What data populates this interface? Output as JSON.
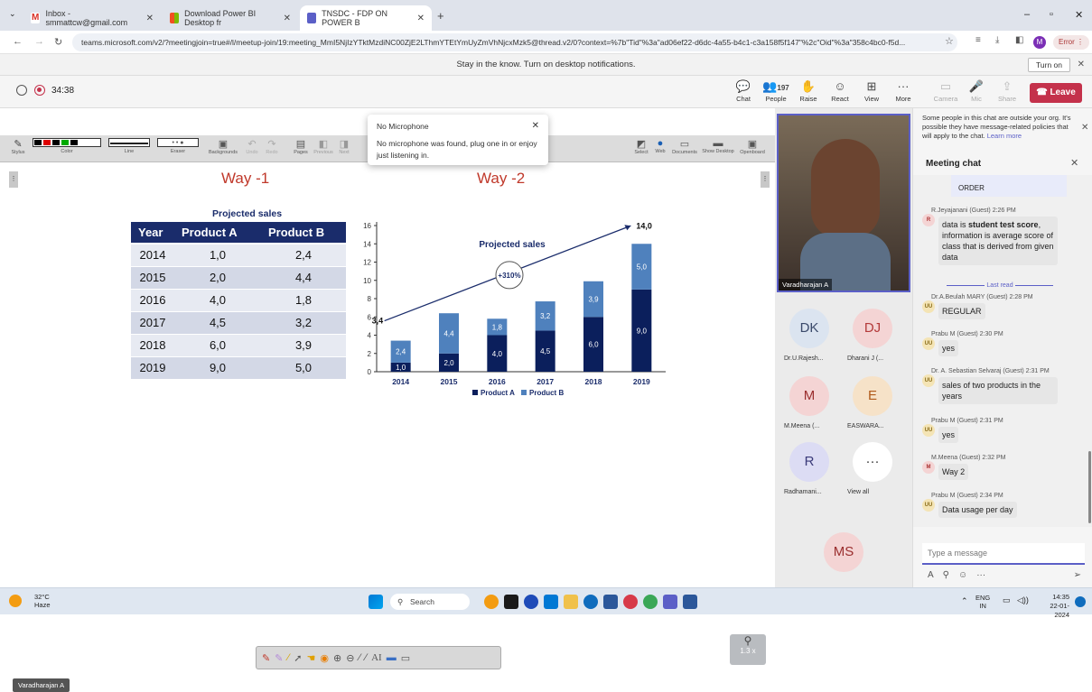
{
  "browser": {
    "tabs": [
      {
        "label": "Inbox - smmattcw@gmail.com",
        "icon": "gmail-icon",
        "color": "#d93025"
      },
      {
        "label": "Download Power BI Desktop fr",
        "icon": "microsoft-icon",
        "color": "#f25022"
      },
      {
        "label": "TNSDC - FDP ON POWER B",
        "icon": "teams-icon",
        "color": "#5b5fc7"
      }
    ],
    "url": "teams.microsoft.com/v2/?meetingjoin=true#/l/meetup-join/19:meeting_MmI5NjIzYTktMzdiNC00ZjE2LThmYTEtYmUyZmVhNjcxMzk5@thread.v2/0?context=%7b\"Tid\"%3a\"ad06ef22-d6dc-4a55-b4c1-c3a158f5f147\"%2c\"Oid\"%3a\"358c4bc0-f5d...",
    "profile_initial": "M",
    "error_label": "Error"
  },
  "notification": {
    "text": "Stay in the know. Turn on desktop notifications.",
    "button": "Turn on"
  },
  "meeting": {
    "timer": "34:38",
    "toolbar": [
      {
        "label": "Chat",
        "icon": "chat-icon",
        "name": "chat"
      },
      {
        "label": "People",
        "icon": "people-icon",
        "name": "people",
        "count": "197"
      },
      {
        "label": "Raise",
        "icon": "raise-hand-icon",
        "name": "raise"
      },
      {
        "label": "React",
        "icon": "react-icon",
        "name": "react"
      },
      {
        "label": "View",
        "icon": "view-icon",
        "name": "view"
      },
      {
        "label": "More",
        "icon": "more-icon",
        "name": "more"
      },
      {
        "label": "Camera",
        "icon": "camera-icon",
        "name": "camera"
      },
      {
        "label": "Mic",
        "icon": "mic-icon",
        "name": "mic"
      },
      {
        "label": "Share",
        "icon": "share-icon",
        "name": "share"
      }
    ],
    "leave": "Leave"
  },
  "popup": {
    "title": "No Microphone",
    "body": "No microphone was found, plug one in or enjoy just listening in."
  },
  "whiteboard": {
    "tool_labels": [
      "Stylus",
      "Color",
      "Line",
      "Eraser",
      "Backgrounds",
      "Undo",
      "Redo",
      "Pages",
      "Previous",
      "Next"
    ],
    "right_tool_labels": [
      "Select",
      "Web",
      "Documents",
      "Show Desktop",
      "Openboard"
    ]
  },
  "slide": {
    "way1": "Way -1",
    "way2": "Way -2",
    "table_title": "Projected sales",
    "table_headers": [
      "Year",
      "Product A",
      "Product B"
    ],
    "table_rows": [
      [
        "2014",
        "1,0",
        "2,4"
      ],
      [
        "2015",
        "2,0",
        "4,4"
      ],
      [
        "2016",
        "4,0",
        "1,8"
      ],
      [
        "2017",
        "4,5",
        "3,2"
      ],
      [
        "2018",
        "6,0",
        "3,9"
      ],
      [
        "2019",
        "9,0",
        "5,0"
      ]
    ]
  },
  "chart_data": {
    "type": "bar",
    "title": "Projected sales",
    "categories": [
      "2014",
      "2015",
      "2016",
      "2017",
      "2018",
      "2019"
    ],
    "series": [
      {
        "name": "Product A",
        "values": [
          1.0,
          2.0,
          4.0,
          4.5,
          6.0,
          9.0
        ],
        "labels": [
          "1,0",
          "2,0",
          "4,0",
          "4,5",
          "6,0",
          "9,0"
        ],
        "color": "#0b1f5c"
      },
      {
        "name": "Product B",
        "values": [
          2.4,
          4.4,
          1.8,
          3.2,
          3.9,
          5.0
        ],
        "labels": [
          "2,4",
          "4,4",
          "1,8",
          "3,2",
          "3,9",
          "5,0"
        ],
        "color": "#4f81bd"
      }
    ],
    "ylim": [
      0,
      16
    ],
    "yticks": [
      "0",
      "2",
      "4",
      "6",
      "8",
      "10",
      "12",
      "14",
      "16"
    ],
    "stacked": true,
    "legend": "bottom",
    "annotations": {
      "start": "3,4",
      "end": "14,0",
      "growth": "+310%"
    }
  },
  "zoom": "1.3 x",
  "presenter_badge": "Varadharajan A",
  "participants": {
    "video_name": "Varadharajan A",
    "tiles": [
      {
        "initials": "DK",
        "name": "Dr.U.Rajesh...",
        "bg": "#dbe4f0",
        "fg": "#3b4a6b"
      },
      {
        "initials": "DJ",
        "name": "Dharani J (...",
        "bg": "#f4d4d4",
        "fg": "#b33a3a"
      },
      {
        "initials": "M",
        "name": "M.Meena (...",
        "bg": "#f4d4d4",
        "fg": "#9a2e2e"
      },
      {
        "initials": "E",
        "name": "EASWARA...",
        "bg": "#f6e2c8",
        "fg": "#b05a1a"
      },
      {
        "initials": "R",
        "name": "Radhamani...",
        "bg": "#dcdcf4",
        "fg": "#3b3b7a"
      },
      {
        "initials": "···",
        "name": "View all",
        "bg": "#ffffff",
        "fg": "#333333"
      }
    ],
    "self_initials": "MS"
  },
  "chat": {
    "banner": "Some people in this chat are outside your org. It's possible they have message-related policies that will apply to the chat.",
    "banner_link": "Learn more",
    "title": "Meeting chat",
    "top_snippet": "ORDER",
    "messages": [
      {
        "meta": "R.Jeyajanani (Guest)  2:26 PM",
        "initials": "R",
        "pre": "data is ",
        "bold": "student test score",
        "post": ", information is average score of class that is derived from given data"
      },
      {
        "meta": "Dr.A.Beulah MARY (Guest)  2:28 PM",
        "initials": "UU",
        "text": "REGULAR"
      },
      {
        "meta": "Prabu M (Guest)  2:30 PM",
        "initials": "UU",
        "text": "yes"
      },
      {
        "meta": "Dr. A. Sebastian Selvaraj (Guest)  2:31 PM",
        "initials": "UU",
        "text": "sales of two products in the years"
      },
      {
        "meta": "Prabu M (Guest)  2:31 PM",
        "initials": "UU",
        "text": "yes"
      },
      {
        "meta": "M.Meena (Guest)  2:32 PM",
        "initials": "M",
        "text": "Way 2"
      },
      {
        "meta": "Prabu M (Guest)  2:34 PM",
        "initials": "UU",
        "text": "Data usage per day"
      }
    ],
    "last_read": "Last read",
    "input_placeholder": "Type a message"
  },
  "taskbar": {
    "temp": "32°C",
    "weather": "Haze",
    "search": "Search",
    "lang": "ENG",
    "region": "IN",
    "time": "14:35",
    "date": "22-01-2024"
  }
}
